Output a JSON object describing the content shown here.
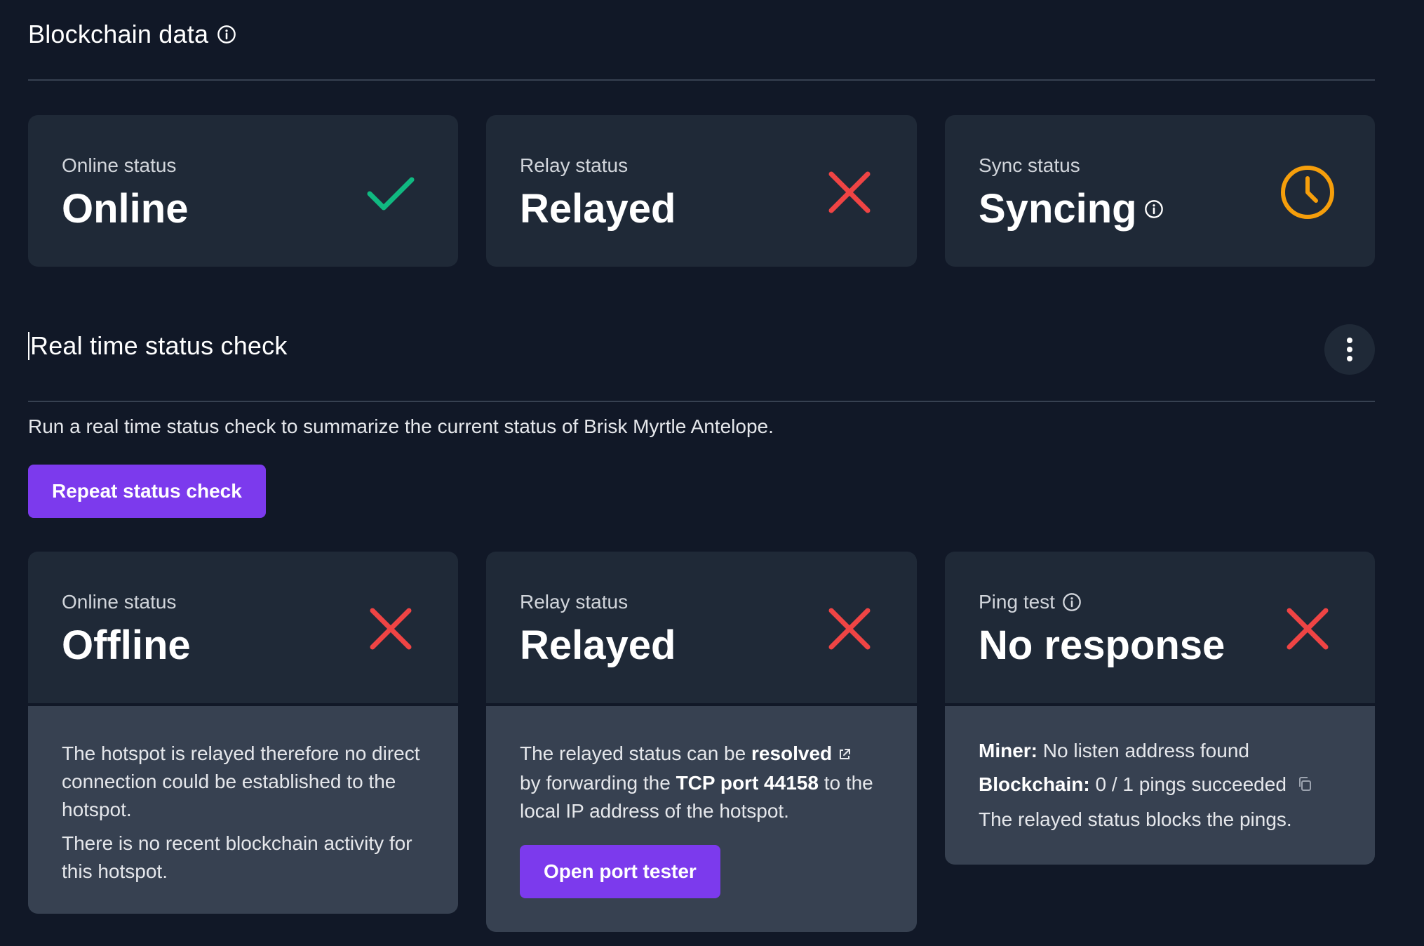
{
  "blockchain": {
    "title": "Blockchain data",
    "cards": [
      {
        "label": "Online status",
        "value": "Online",
        "icon": "check-icon"
      },
      {
        "label": "Relay status",
        "value": "Relayed",
        "icon": "x-icon"
      },
      {
        "label": "Sync status",
        "value": "Syncing",
        "icon": "clock-icon"
      }
    ]
  },
  "realtime": {
    "title": "Real time status check",
    "description": "Run a real time status check to summarize the current status of Brisk Myrtle Antelope.",
    "repeat_button": "Repeat status check",
    "cards": [
      {
        "label": "Online status",
        "value": "Offline",
        "icon": "x-icon",
        "details": [
          "The hotspot is relayed therefore no direct connection could be established to the hotspot.",
          "There is no recent blockchain activity for this hotspot."
        ]
      },
      {
        "label": "Relay status",
        "value": "Relayed",
        "icon": "x-icon",
        "detail_prefix": "The relayed status can be ",
        "detail_link": "resolved",
        "detail_mid": "by forwarding the ",
        "detail_port": "TCP port 44158",
        "detail_suffix": " to the local IP address of the hotspot.",
        "button": "Open port tester"
      },
      {
        "label": "Ping test",
        "value": "No response",
        "icon": "x-icon",
        "miner_label": "Miner:",
        "miner_value": " No listen address found",
        "blockchain_label": "Blockchain:",
        "blockchain_value": " 0 / 1 pings succeeded",
        "note": "The relayed status blocks the pings."
      }
    ]
  },
  "colors": {
    "background": "#111827",
    "card": "#1f2937",
    "card_bottom": "#374151",
    "accent": "#7c3aed",
    "success": "#10b981",
    "error": "#ef4444",
    "warning": "#f59e0b"
  }
}
